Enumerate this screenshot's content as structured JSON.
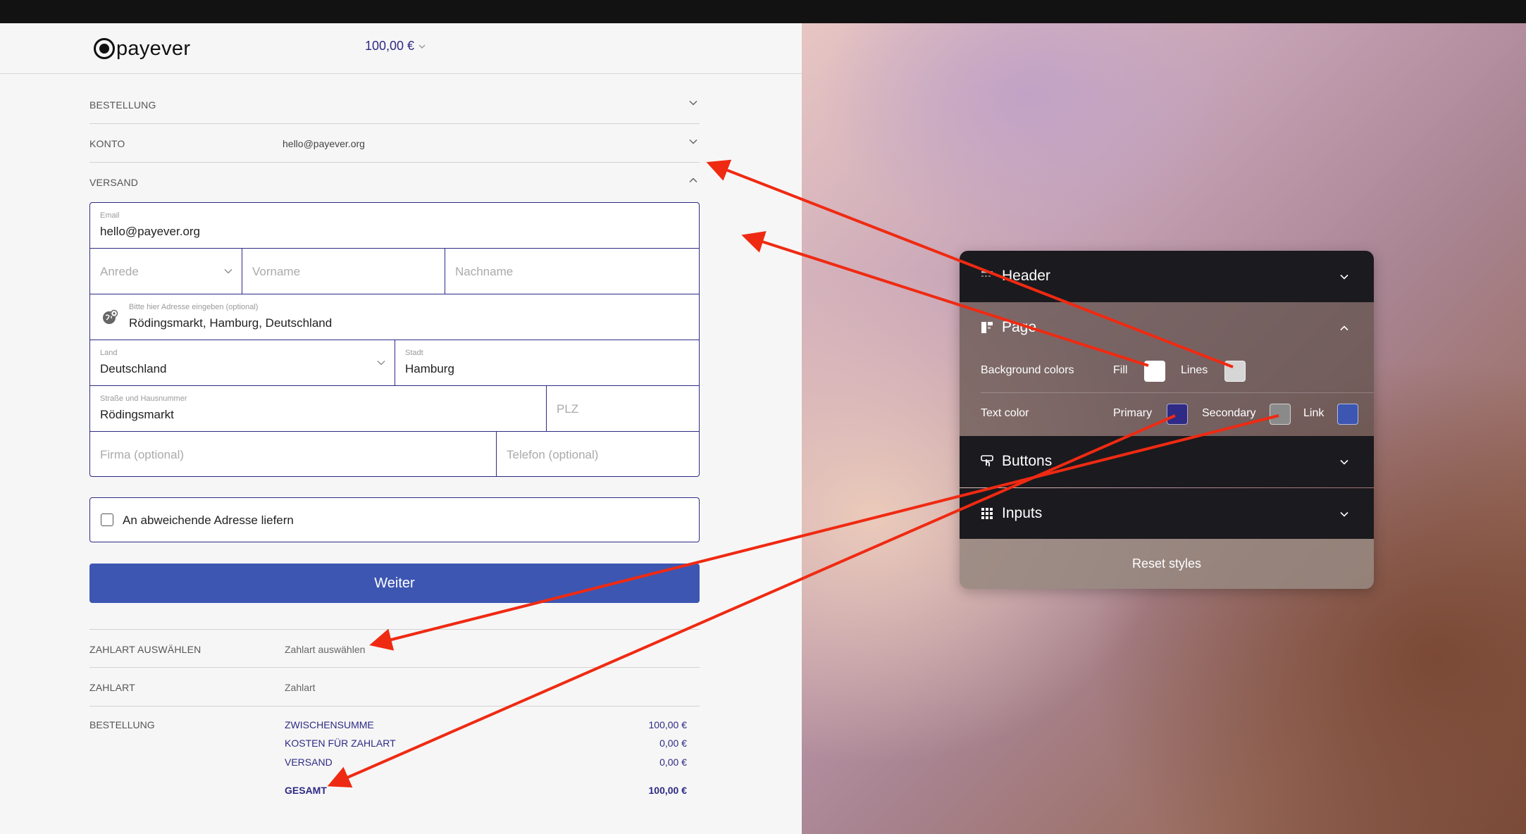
{
  "header": {
    "logo_text": "payever",
    "amount": "100,00 €"
  },
  "sections": {
    "bestellung_label": "BESTELLUNG",
    "konto_label": "KONTO",
    "konto_value": "hello@payever.org",
    "versand_label": "VERSAND"
  },
  "form": {
    "email_label": "Email",
    "email_value": "hello@payever.org",
    "anrede_placeholder": "Anrede",
    "vorname_placeholder": "Vorname",
    "nachname_placeholder": "Nachname",
    "address_label": "Bitte hier Adresse eingeben (optional)",
    "address_value": "Rödingsmarkt, Hamburg, Deutschland",
    "land_label": "Land",
    "land_value": "Deutschland",
    "stadt_label": "Stadt",
    "stadt_value": "Hamburg",
    "strasse_label": "Straße und Hausnummer",
    "strasse_value": "Rödingsmarkt",
    "plz_placeholder": "PLZ",
    "firma_placeholder": "Firma (optional)",
    "telefon_placeholder": "Telefon (optional)"
  },
  "alt_address_label": "An abweichende Adresse liefern",
  "weiter_label": "Weiter",
  "payment": {
    "select_label": "ZAHLART AUSWÄHLEN",
    "select_value": "Zahlart auswählen",
    "zahlart_label": "ZAHLART",
    "zahlart_value": "Zahlart"
  },
  "summary": {
    "label": "BESTELLUNG",
    "lines": [
      {
        "label": "ZWISCHENSUMME",
        "amount": "100,00 €"
      },
      {
        "label": "KOSTEN FÜR ZAHLART",
        "amount": "0,00 €"
      },
      {
        "label": "VERSAND",
        "amount": "0,00 €"
      }
    ],
    "total_label": "GESAMT",
    "total_amount": "100,00 €"
  },
  "panel": {
    "header_title": "Header",
    "page_title": "Page",
    "bg_colors_label": "Background colors",
    "fill_label": "Fill",
    "lines_label": "Lines",
    "text_color_label": "Text color",
    "primary_label": "Primary",
    "secondary_label": "Secondary",
    "link_label": "Link",
    "buttons_title": "Buttons",
    "inputs_title": "Inputs",
    "reset_label": "Reset styles"
  },
  "colors": {
    "primary_text": "#2e2a85",
    "secondary_text": "#8a8a8a",
    "link": "#3d56b2",
    "fill": "#ffffff",
    "lines": "#d6d6d6",
    "button": "#3d56b2",
    "arrow": "#ef2a12"
  },
  "icons": [
    "payever-logo-icon",
    "chevron-down-icon",
    "chevron-up-icon",
    "globe-pin-icon",
    "header-layout-icon",
    "page-layout-icon",
    "button-hand-icon",
    "grid-dots-icon"
  ]
}
